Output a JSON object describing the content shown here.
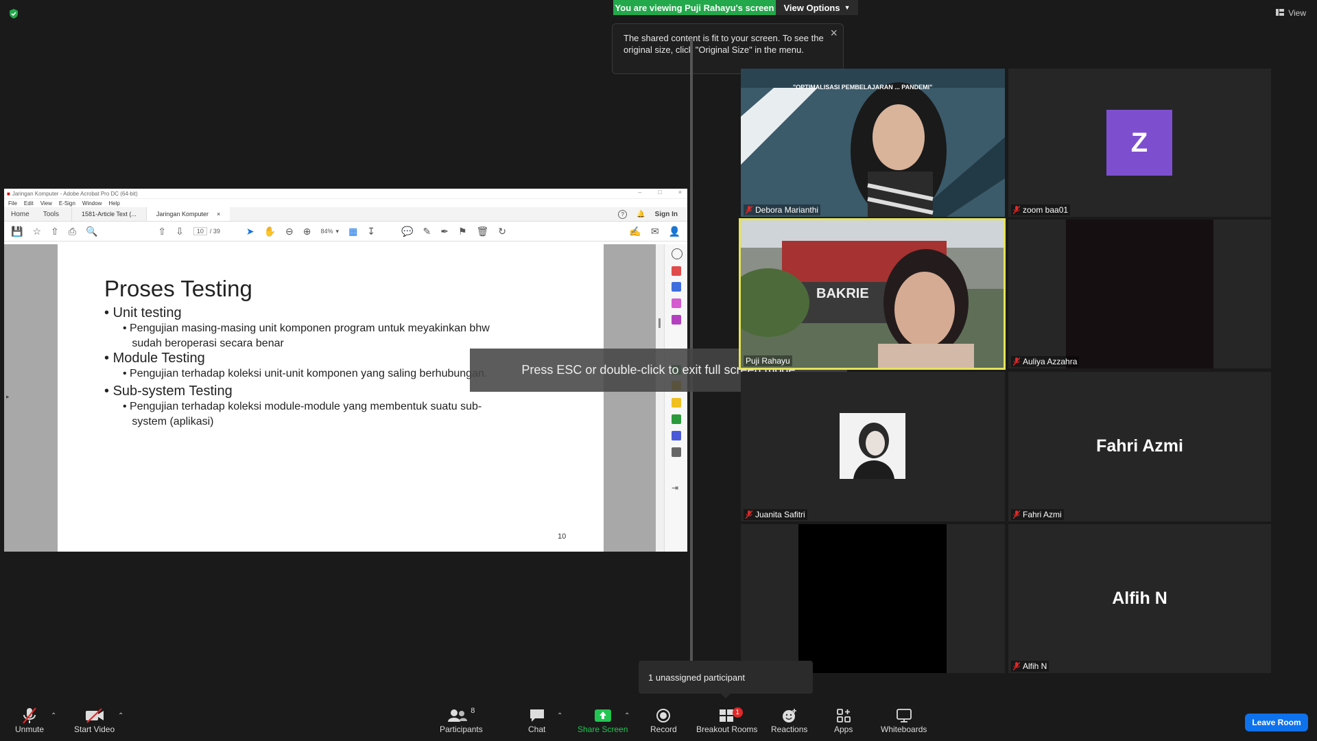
{
  "top": {
    "viewing_banner": "You are viewing Puji Rahayu's screen",
    "view_options": "View Options",
    "view_right": "View",
    "tooltip_text": "The shared content is fit to your screen. To see the original size, click \"Original Size\" in the menu."
  },
  "acrobat": {
    "title": "Jaringan Komputer - Adobe Acrobat Pro DC (64-bit)",
    "menu": [
      "File",
      "Edit",
      "View",
      "E-Sign",
      "Window",
      "Help"
    ],
    "tabs": [
      "Home",
      "Tools"
    ],
    "doc_tabs": [
      "1581-Article Text (...",
      "Jaringan Komputer"
    ],
    "sign_in": "Sign In",
    "page_current": "10",
    "page_total": "/ 39",
    "zoom": "84%",
    "slide": {
      "title": "Proses Testing",
      "b1": "Unit testing",
      "b1_sub_line1": "Pengujian masing-masing unit komponen program untuk meyakinkan bhw",
      "b1_sub_line2": "sudah beroperasi secara benar",
      "b2": "Module Testing",
      "b2_sub": "Pengujian terhadap koleksi unit-unit komponen yang saling berhubungan.",
      "b3": "Sub-system Testing",
      "b3_sub_line1": "Pengujian terhadap koleksi module-module yang membentuk suatu sub-",
      "b3_sub_line2": "system (aplikasi)",
      "page_number": "10"
    }
  },
  "esc_message": "Press ESC or double-click to exit full screen mode",
  "participants": [
    {
      "name": "Debora Marianthi",
      "banner_text": "\"OPTIMALISASI PEMBELAJARAN ... PANDEMI\""
    },
    {
      "name": "zoom baa01",
      "initial": "Z",
      "avatar_color": "#7d4fcf"
    },
    {
      "name": "Puji Rahayu",
      "active_speaker": true,
      "sign_text": "BAKRIE"
    },
    {
      "name": "Auliya Azzahra"
    },
    {
      "name": "Juanita Safitri"
    },
    {
      "name": "Fahri Azmi",
      "display_text": "Fahri Azmi"
    },
    {
      "name": "",
      "video_off": true
    },
    {
      "name": "Alfih N",
      "display_text": "Alfih N"
    }
  ],
  "unassigned": "1 unassigned participant",
  "toolbar": {
    "unmute": "Unmute",
    "start_video": "Start Video",
    "participants": "Participants",
    "participants_count": "8",
    "chat": "Chat",
    "share_screen": "Share Screen",
    "record": "Record",
    "breakout_rooms": "Breakout Rooms",
    "breakout_badge": "1",
    "reactions": "Reactions",
    "apps": "Apps",
    "whiteboards": "Whiteboards",
    "leave_room": "Leave Room"
  },
  "colors": {
    "banner_green": "#23a84b",
    "active_speaker_border": "#e5e35a",
    "leave_blue": "#0e72ed",
    "muted_red": "#e02828",
    "avatar_purple": "#7d4fcf"
  }
}
